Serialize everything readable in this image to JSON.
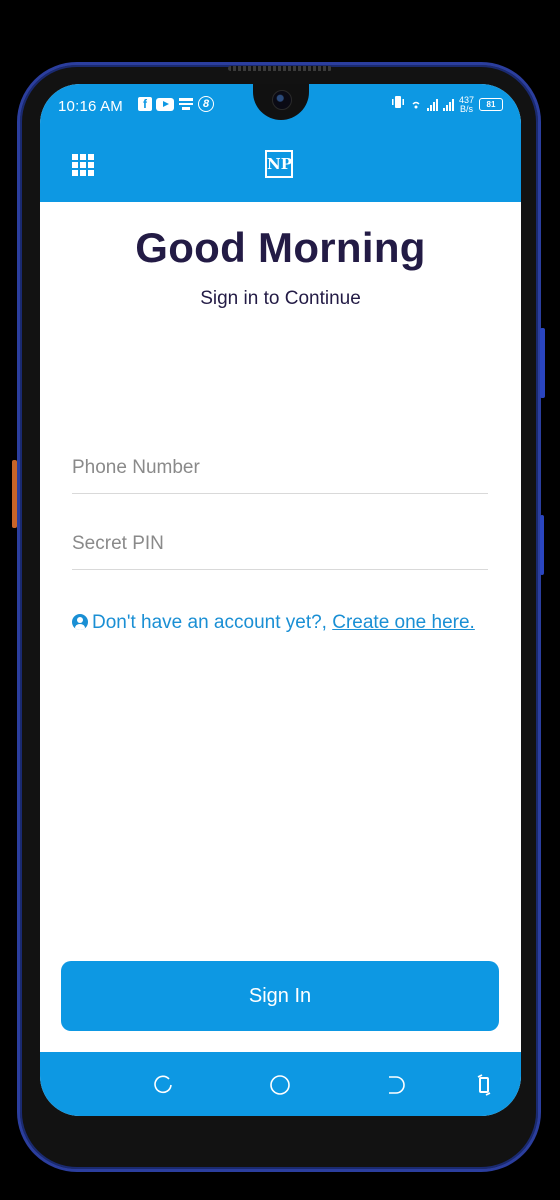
{
  "status_bar": {
    "time": "10:16 AM",
    "left_icons": [
      "facebook-icon",
      "youtube-icon",
      "message-icon",
      "viber-icon"
    ],
    "net_speed_value": "437",
    "net_speed_unit": "B/s",
    "battery": "81"
  },
  "app_bar": {
    "logo_text": "NP"
  },
  "login": {
    "greeting": "Good Morning",
    "subtitle": "Sign in to Continue",
    "phone_placeholder": "Phone Number",
    "pin_placeholder": "Secret PIN",
    "signup_prompt": "Don't have an account yet?,",
    "signup_link": "Create one here.",
    "signin_button": "Sign In"
  },
  "colors": {
    "primary": "#0d98e3",
    "title": "#231b45",
    "link": "#1a8fd4"
  }
}
